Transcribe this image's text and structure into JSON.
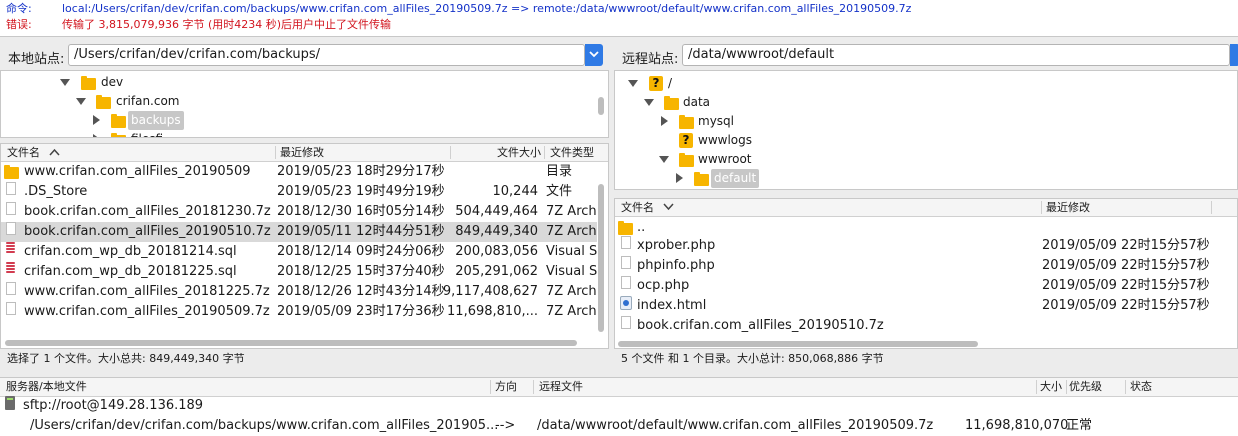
{
  "log": {
    "command_tag": "命令:",
    "command_text": "local:/Users/crifan/dev/crifan.com/backups/www.crifan.com_allFiles_20190509.7z => remote:/data/wwwroot/default/www.crifan.com_allFiles_20190509.7z",
    "error_tag": "错误:",
    "error_text": "传输了 3,815,079,936 字节 (用时4234 秒)后用户中止了文件传输"
  },
  "local": {
    "site_label": "本地站点:",
    "site_path": "/Users/crifan/dev/crifan.com/backups/",
    "tree": [
      {
        "label": "dev"
      },
      {
        "label": "crifan.com"
      },
      {
        "label": "backups"
      },
      {
        "label": "filesfi"
      }
    ],
    "columns": [
      "文件名",
      "最近修改",
      "文件大小",
      "文件类型"
    ],
    "files": [
      {
        "name": "www.crifan.com_allFiles_20190509",
        "modified": "2019/05/23 18时29分17秒",
        "size": "",
        "type": "目录"
      },
      {
        "name": ".DS_Store",
        "modified": "2019/05/23 19时49分19秒",
        "size": "10,244",
        "type": "文件"
      },
      {
        "name": "book.crifan.com_allFiles_20181230.7z",
        "modified": "2018/12/30 16时05分14秒",
        "size": "504,449,464",
        "type": "7Z Arch"
      },
      {
        "name": "book.crifan.com_allFiles_20190510.7z",
        "modified": "2019/05/11 12时44分51秒",
        "size": "849,449,340",
        "type": "7Z Arch"
      },
      {
        "name": "crifan.com_wp_db_20181214.sql",
        "modified": "2018/12/14 09时24分06秒",
        "size": "200,083,056",
        "type": "Visual S"
      },
      {
        "name": "crifan.com_wp_db_20181225.sql",
        "modified": "2018/12/25 15时37分40秒",
        "size": "205,291,062",
        "type": "Visual S"
      },
      {
        "name": "www.crifan.com_allFiles_20181225.7z",
        "modified": "2018/12/26 12时43分14秒",
        "size": "9,117,408,627",
        "type": "7Z Arch"
      },
      {
        "name": "www.crifan.com_allFiles_20190509.7z",
        "modified": "2019/05/09 23时17分36秒",
        "size": "11,698,810,...",
        "type": "7Z Arch"
      }
    ],
    "status": "选择了 1 个文件。大小总共: 849,449,340 字节"
  },
  "remote": {
    "site_label": "远程站点:",
    "site_path": "/data/wwwroot/default",
    "tree": [
      {
        "label": "/"
      },
      {
        "label": "data"
      },
      {
        "label": "mysql"
      },
      {
        "label": "wwwlogs"
      },
      {
        "label": "wwwroot"
      },
      {
        "label": "default"
      }
    ],
    "columns": [
      "文件名",
      "最近修改"
    ],
    "files": [
      {
        "name": "..",
        "modified": ""
      },
      {
        "name": "xprober.php",
        "modified": "2019/05/09 22时15分57秒"
      },
      {
        "name": "phpinfo.php",
        "modified": "2019/05/09 22时15分57秒"
      },
      {
        "name": "ocp.php",
        "modified": "2019/05/09 22时15分57秒"
      },
      {
        "name": "index.html",
        "modified": "2019/05/09 22时15分57秒"
      },
      {
        "name": "book.crifan.com_allFiles_20190510.7z",
        "modified": ""
      }
    ],
    "status": "5 个文件 和 1 个目录。大小总计: 850,068,886 字节"
  },
  "queue": {
    "columns": [
      "服务器/本地文件",
      "方向",
      "远程文件",
      "大小",
      "优先级",
      "状态"
    ],
    "server": "sftp://root@149.28.136.189",
    "item": {
      "local": "/Users/crifan/dev/crifan.com/backups/www.crifan.com_allFiles_201905...",
      "direction": "-->",
      "remote": "/data/wwwroot/default/www.crifan.com_allFiles_20190509.7z",
      "size": "11,698,810,070",
      "priority": "正常"
    }
  },
  "colors": {
    "accent": "#2f7ae5",
    "folder": "#f7b500",
    "error": "#d2141e",
    "command": "#1432c8"
  }
}
